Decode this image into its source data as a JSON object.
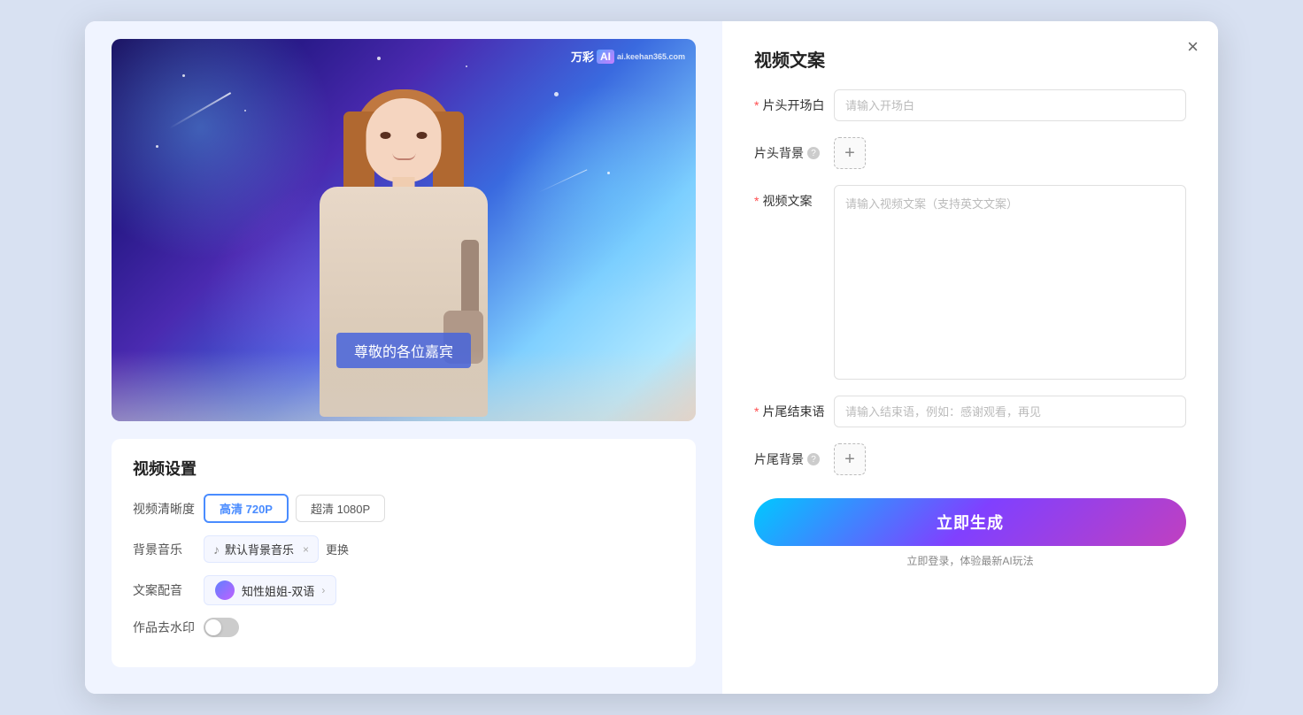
{
  "modal": {
    "close_label": "×"
  },
  "left": {
    "watermark": "万彩",
    "watermark_ai": "AI",
    "watermark_sub": "ai.keehan365.com",
    "subtitle": "尊敬的各位嘉宾",
    "settings_title": "视频设置",
    "quality_label": "视频清晰度",
    "quality_options": [
      {
        "label": "高清 720P",
        "active": true
      },
      {
        "label": "超清 1080P",
        "active": false
      }
    ],
    "music_label": "背景音乐",
    "music_name": "默认背景音乐",
    "music_change": "更换",
    "voice_label": "文案配音",
    "voice_name": "知性姐姐-双语",
    "watermark_label": "作品去水印"
  },
  "right": {
    "title": "视频文案",
    "opening_label": "片头开场白",
    "opening_required": "*",
    "opening_placeholder": "请输入开场白",
    "bg_label": "片头背景",
    "bg_help": "?",
    "copy_label": "视频文案",
    "copy_required": "*",
    "copy_placeholder": "请输入视频文案（支持英文文案）",
    "ending_label": "片尾结束语",
    "ending_required": "*",
    "ending_placeholder": "请输入结束语，例如：感谢观看，再见",
    "tail_bg_label": "片尾背景",
    "tail_bg_help": "?",
    "generate_label": "立即生成",
    "login_hint": "立即登录，体验最新AI玩法"
  }
}
